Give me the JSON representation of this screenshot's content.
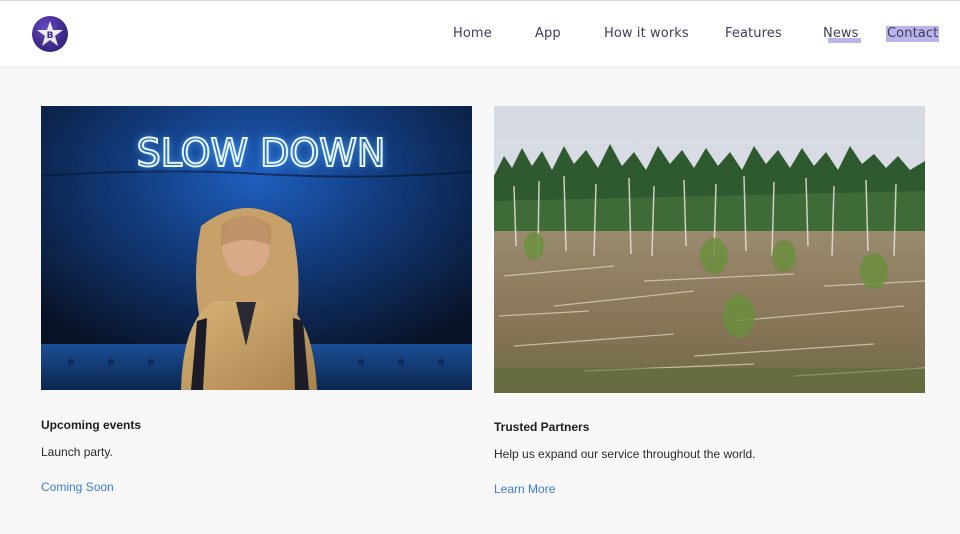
{
  "header": {
    "logo_letter": "B",
    "logo_icon": "star-badge-icon",
    "nav": [
      {
        "label": "Home"
      },
      {
        "label": "App"
      },
      {
        "label": "How it works"
      },
      {
        "label": "Features"
      },
      {
        "label": "News"
      },
      {
        "label": "Contact"
      }
    ]
  },
  "cards": [
    {
      "image_text": "SLOW DOWN",
      "title": "Upcoming events",
      "text": "Launch party.",
      "link": "Coming Soon"
    },
    {
      "title": "Trusted Partners",
      "text": "Help us expand our service throughout the world.",
      "link": "Learn More"
    }
  ],
  "colors": {
    "accent_link": "#3a7bd5",
    "nav_highlight": "#b9b4ea",
    "logo": "#3f2a8c",
    "neon": "#4aa8ff"
  }
}
